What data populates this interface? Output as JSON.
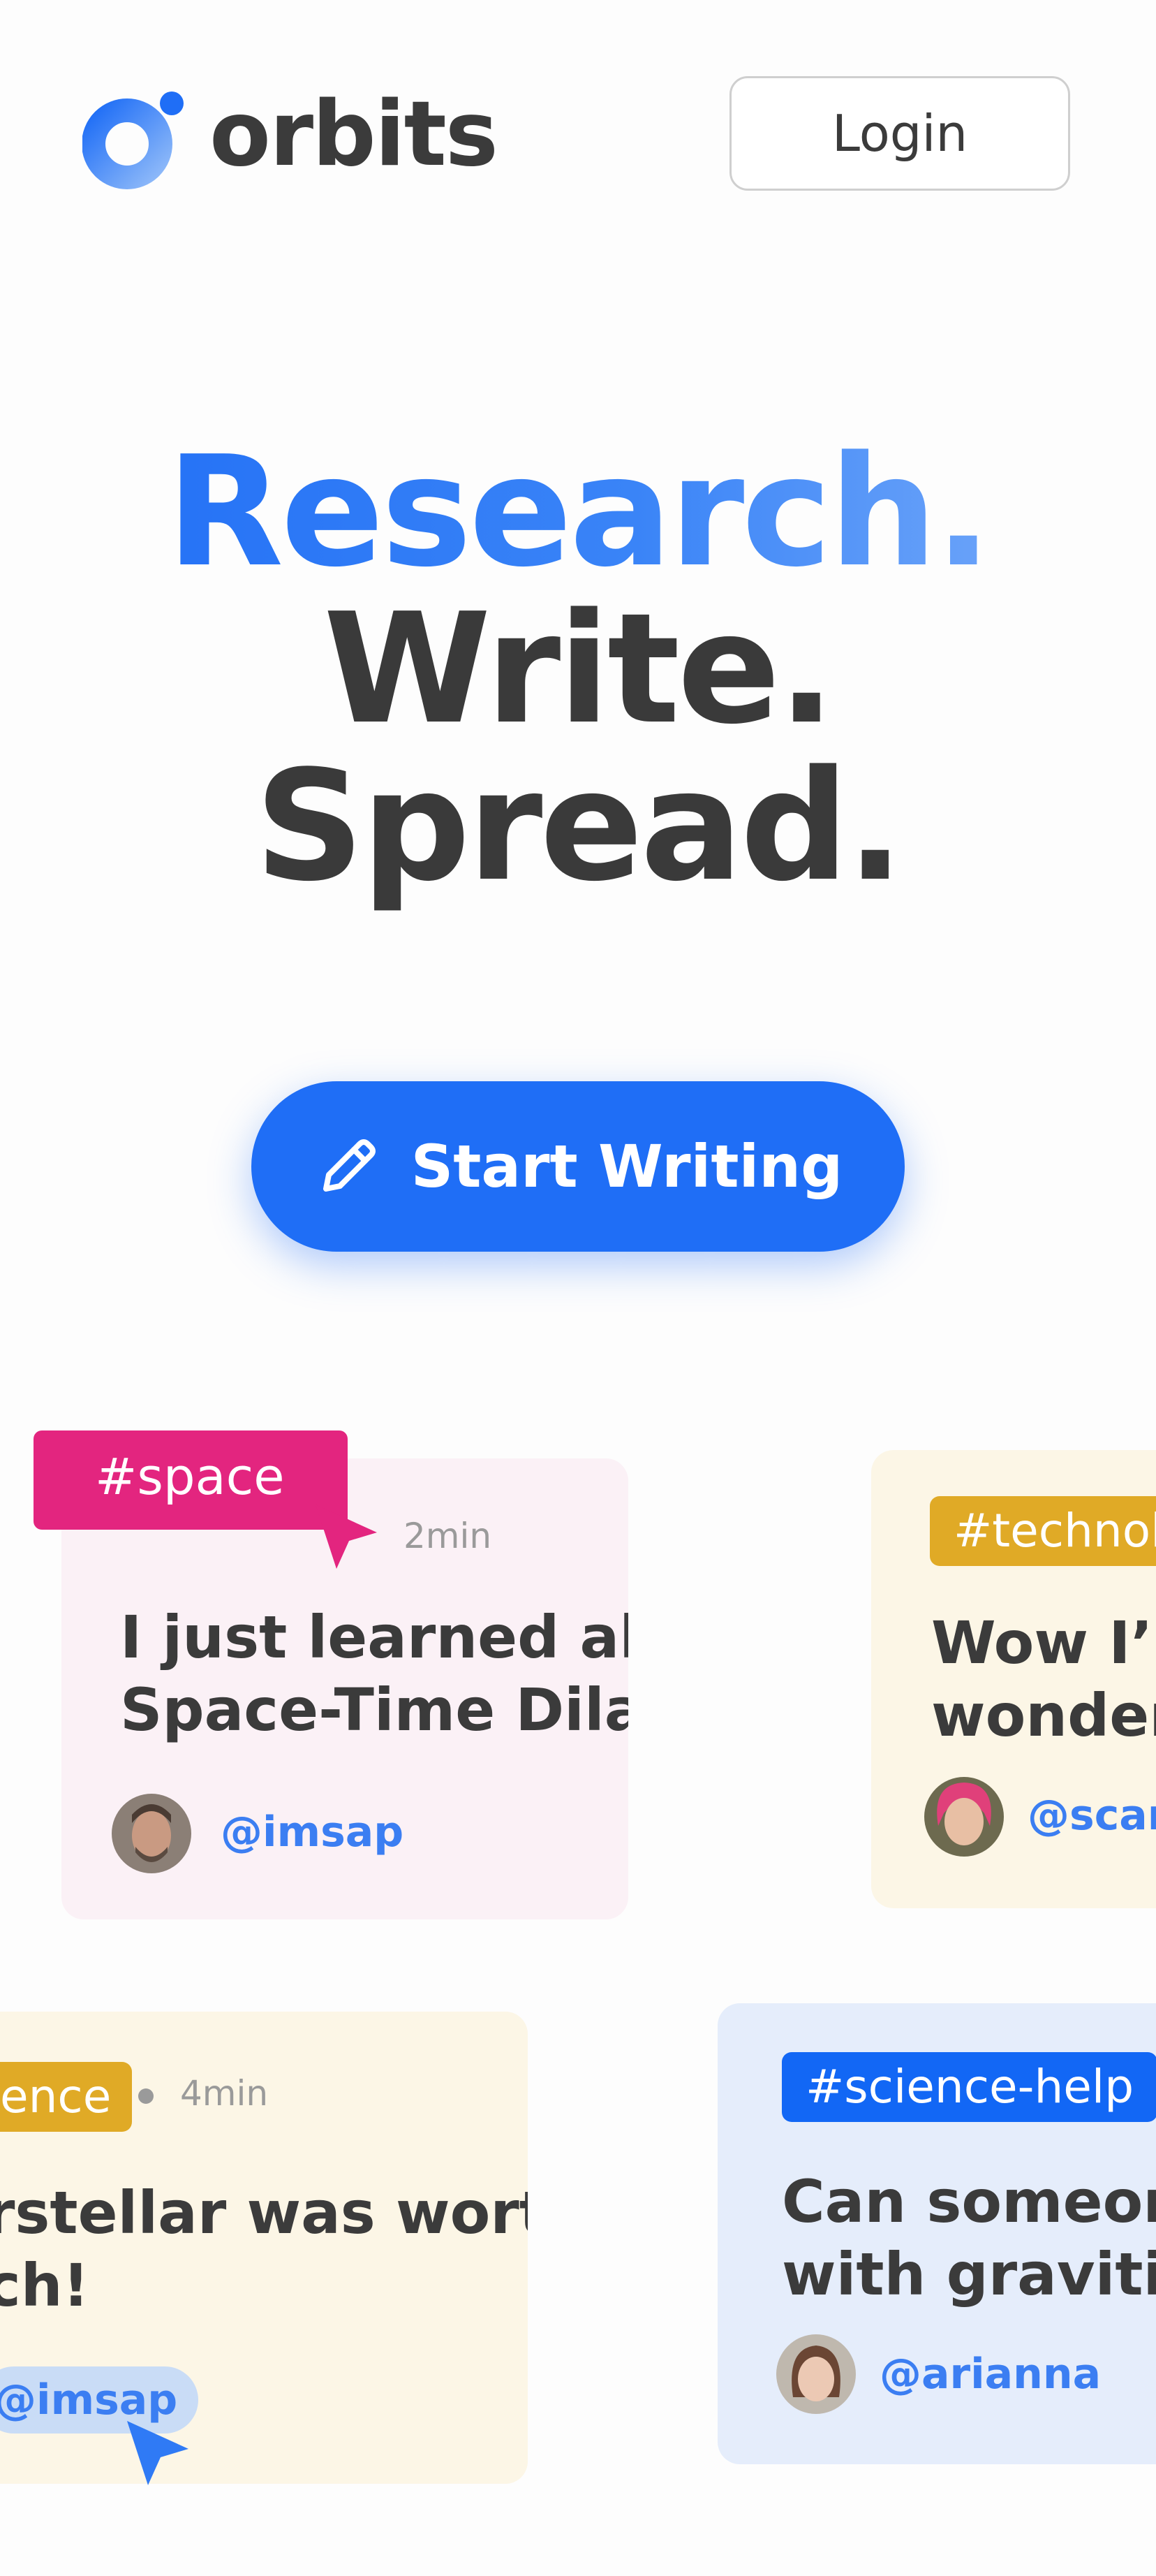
{
  "header": {
    "brand": "orbits",
    "login_label": "Login"
  },
  "hero": {
    "line1": "Research.",
    "line2": "Write.",
    "line3": "Spread.",
    "cta_label": "Start Writing"
  },
  "cards": [
    {
      "tag": "#space",
      "time": "2min",
      "title_line1": "I just learned about",
      "title_line2": "Space-Time Dilation!",
      "handle": "@imsap"
    },
    {
      "tag": "#technolo",
      "title_line1": "Wow I’r",
      "title_line2": "wonder",
      "handle": "@scar"
    },
    {
      "tag": "ence",
      "time": "4min",
      "title_line1": "rstellar was worth a",
      "title_line2": "ch!",
      "handle": "@imsap"
    },
    {
      "tag": "#science-help",
      "title_line1": "Can someon",
      "title_line2": "with gravitit",
      "handle": "@arianna"
    }
  ],
  "colors": {
    "brand_blue": "#1f6ef6",
    "pink_tag": "#e3257f",
    "gold_tag": "#e0aa26",
    "blue_tag": "#1267f5",
    "pink_card": "#fbf1f6",
    "cream_card": "#fcf6e6",
    "blue_card": "#e5edfb"
  },
  "icons": [
    "orbits-logo-icon",
    "pencil-icon",
    "cursor-pointer-icon"
  ]
}
